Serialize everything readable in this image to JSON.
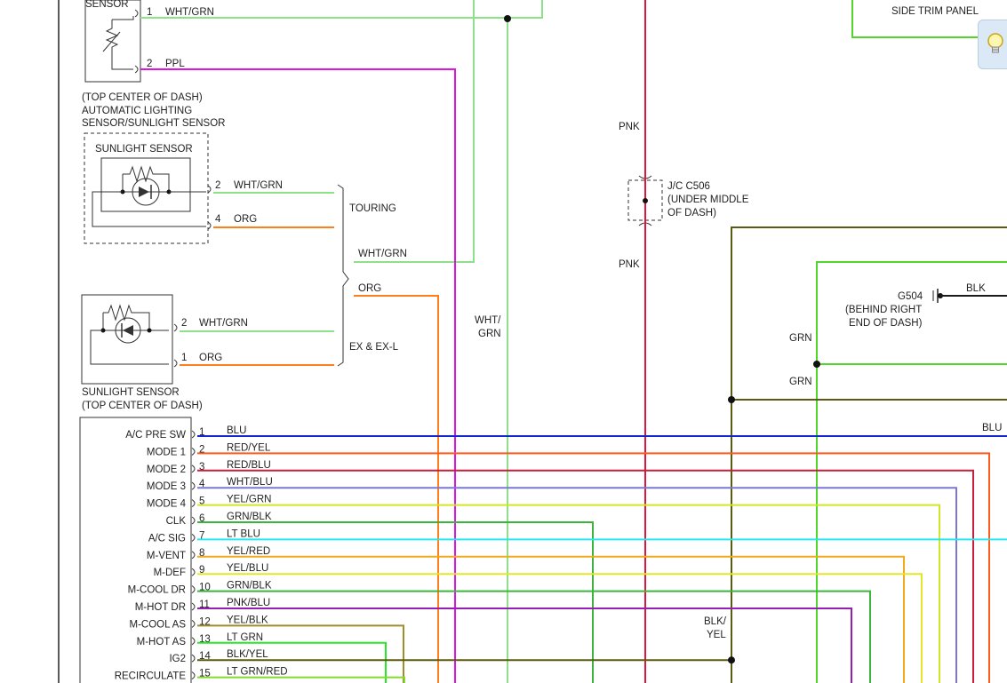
{
  "diagram": {
    "colors": {
      "WHT/GRN": "#8fe08a",
      "PPL": "#e014e0",
      "ORG": "#ff7d1a",
      "PNK": "#e0143c",
      "GRN": "#52d62a",
      "BLK": "#1a1a1a",
      "BLK/YEL": "#5a5a10",
      "BLU": "#1428d2",
      "RED/YEL": "#ff5a1e",
      "RED/BLU": "#c81e3c",
      "WHT/BLU": "#7878d2",
      "YEL/GRN": "#d2e628",
      "GRN/BLK": "#3cb43c",
      "LT BLU": "#28e6f0",
      "YEL/RED": "#f0aa1e",
      "YEL/BLU": "#e6e628",
      "PNK/BLU": "#961eb4",
      "YEL/BLK": "#a08c28",
      "LT GRN": "#28e628",
      "LT GRN/RED": "#82dc2d"
    },
    "top_sensor": {
      "label_partial": "SENSOR",
      "pins": [
        {
          "num": "1",
          "wire": "WHT/GRN"
        },
        {
          "num": "2",
          "wire": "PPL"
        }
      ],
      "caption": [
        "(TOP CENTER OF DASH)",
        "AUTOMATIC LIGHTING",
        "SENSOR/SUNLIGHT SENSOR"
      ]
    },
    "sunlight_sensor_touring": {
      "title": "SUNLIGHT SENSOR",
      "pins": [
        {
          "num": "2",
          "wire": "WHT/GRN"
        },
        {
          "num": "4",
          "wire": "ORG"
        }
      ]
    },
    "touring_label": "TOURING",
    "bundle_out": {
      "upper_wire": "WHT/GRN",
      "lower_wire": "ORG"
    },
    "sunlight_sensor_ex": {
      "pins": [
        {
          "num": "2",
          "wire": "WHT/GRN"
        },
        {
          "num": "1",
          "wire": "ORG"
        }
      ],
      "caption": [
        "SUNLIGHT SENSOR",
        "(TOP CENTER OF DASH)"
      ]
    },
    "ex_label": "EX & EX-L",
    "center_wire": {
      "line1": "WHT/",
      "line2": "GRN"
    },
    "junction": {
      "wire_top": "PNK",
      "wire_bottom": "PNK",
      "label": [
        "J/C C506",
        "(UNDER MIDDLE",
        "OF DASH)"
      ]
    },
    "side_trim": "SIDE TRIM PANEL",
    "ground": {
      "name": "G504",
      "wire": "BLK",
      "location": [
        "(BEHIND RIGHT",
        "END OF DASH)"
      ]
    },
    "grn_labels": [
      "GRN",
      "GRN"
    ],
    "blk_yel_label": {
      "line1": "BLK/",
      "line2": "YEL"
    },
    "blu_right_label": "BLU",
    "control_unit": {
      "pins": [
        {
          "num": "1",
          "name": "A/C PRE SW",
          "wire": "BLU"
        },
        {
          "num": "2",
          "name": "MODE 1",
          "wire": "RED/YEL"
        },
        {
          "num": "3",
          "name": "MODE 2",
          "wire": "RED/BLU"
        },
        {
          "num": "4",
          "name": "MODE 3",
          "wire": "WHT/BLU"
        },
        {
          "num": "5",
          "name": "MODE 4",
          "wire": "YEL/GRN"
        },
        {
          "num": "6",
          "name": "CLK",
          "wire": "GRN/BLK"
        },
        {
          "num": "7",
          "name": "A/C SIG",
          "wire": "LT BLU"
        },
        {
          "num": "8",
          "name": "M-VENT",
          "wire": "YEL/RED"
        },
        {
          "num": "9",
          "name": "M-DEF",
          "wire": "YEL/BLU"
        },
        {
          "num": "10",
          "name": "M-COOL DR",
          "wire": "GRN/BLK"
        },
        {
          "num": "11",
          "name": "M-HOT DR",
          "wire": "PNK/BLU"
        },
        {
          "num": "12",
          "name": "M-COOL AS",
          "wire": "YEL/BLK"
        },
        {
          "num": "13",
          "name": "M-HOT AS",
          "wire": "LT GRN"
        },
        {
          "num": "14",
          "name": "IG2",
          "wire": "BLK/YEL"
        },
        {
          "num": "15",
          "name": "RECIRCULATE",
          "wire": "LT GRN/RED"
        }
      ]
    }
  },
  "hint": {
    "icon": "lightbulb-icon"
  }
}
